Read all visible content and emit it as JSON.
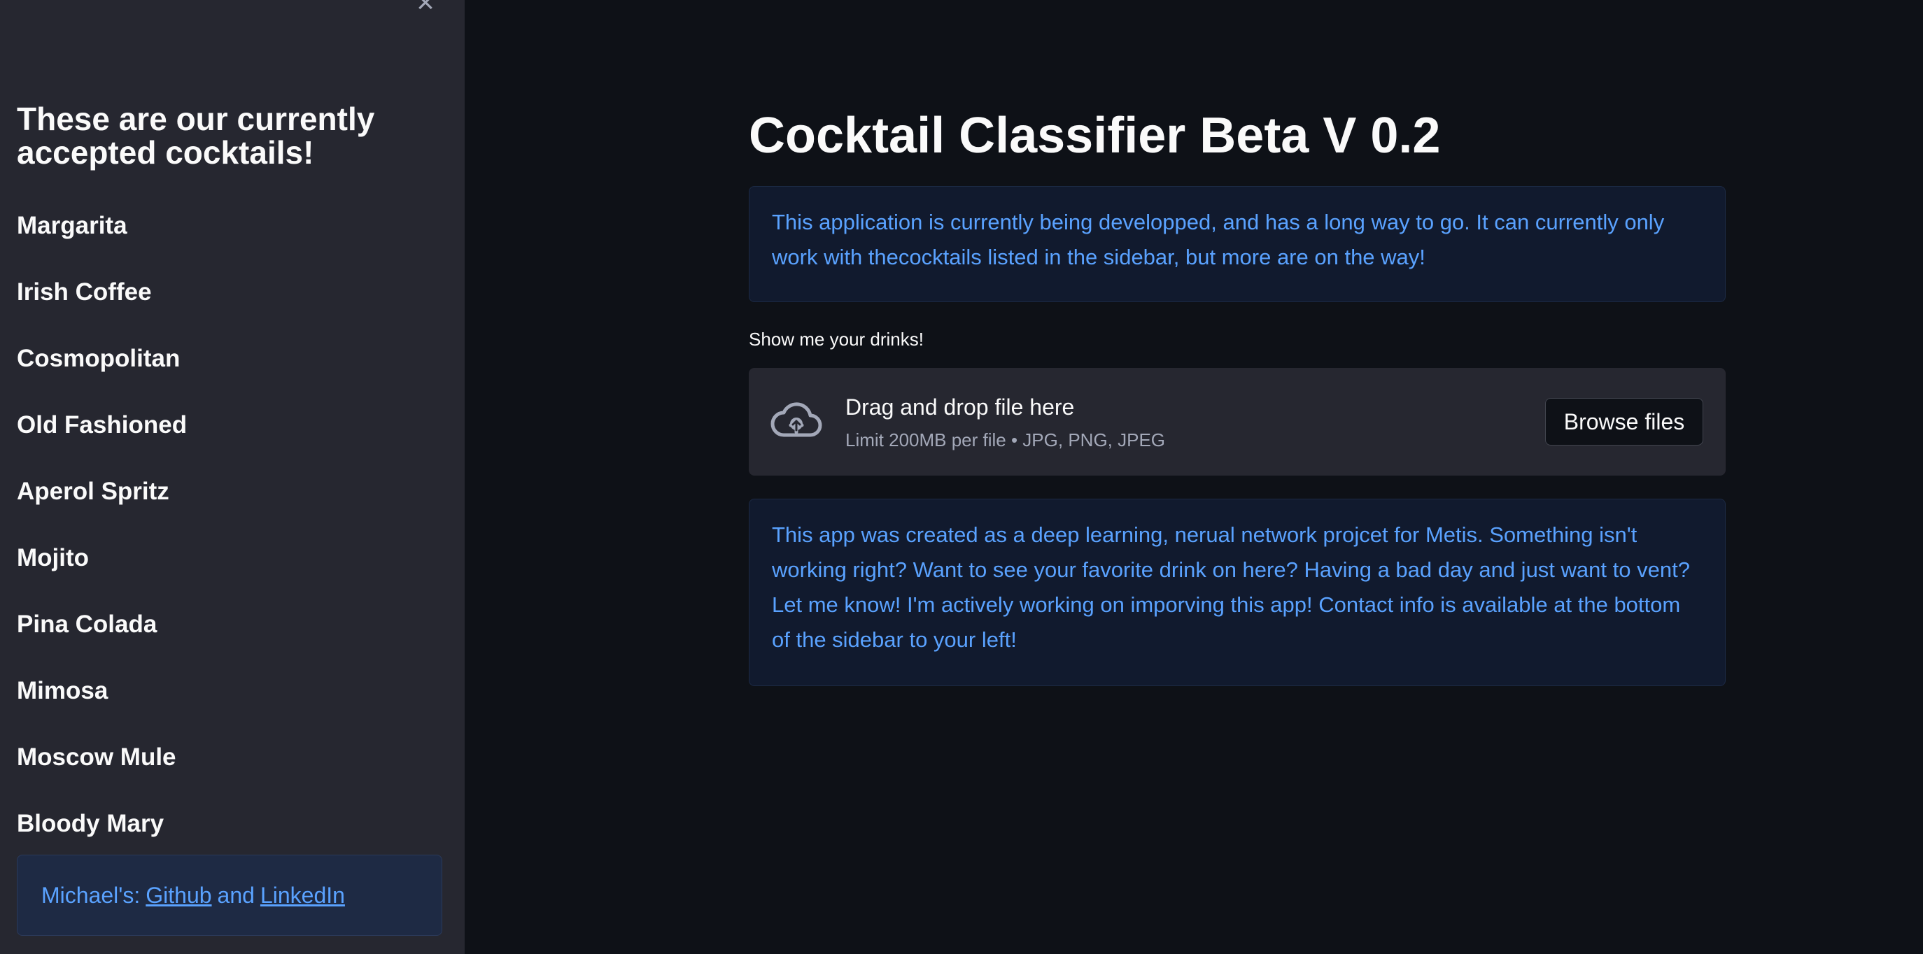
{
  "sidebar": {
    "close_label": "×",
    "heading": "These are our currently accepted cocktails!",
    "cocktails": [
      "Margarita",
      "Irish Coffee",
      "Cosmopolitan",
      "Old Fashioned",
      "Aperol Spritz",
      "Mojito",
      "Pina Colada",
      "Mimosa",
      "Moscow Mule",
      "Bloody Mary"
    ],
    "contact": {
      "prefix": "Michael's:",
      "github_label": "Github",
      "conjunction": "and",
      "linkedin_label": "LinkedIn"
    }
  },
  "main": {
    "title": "Cocktail Classifier Beta V 0.2",
    "info_top": "This application is currently being developped, and has a long way to go. It can currently only work with thecocktails listed in the sidebar, but more are on the way!",
    "uploader": {
      "label": "Show me your drinks!",
      "drag_text": "Drag and drop file here",
      "limit_text": "Limit 200MB per file • JPG, PNG, JPEG",
      "browse_label": "Browse files",
      "icon": "cloud-upload-icon"
    },
    "info_bottom": "This app was created as a deep learning, nerual network projcet for Metis. Something isn't working right? Want to see your favorite drink on here? Having a bad day and just want to vent? Let me know! I'm actively working on imporving this app! Contact info is available at the bottom of the sidebar to your left!"
  },
  "colors": {
    "background": "#0e1117",
    "sidebar": "#262730",
    "info_text": "#5aa2ff",
    "info_bg": "#111a2e"
  }
}
